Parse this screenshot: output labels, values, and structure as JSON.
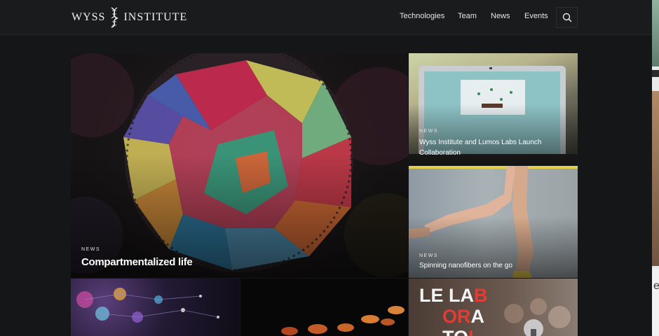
{
  "header": {
    "logo_left": "WYSS",
    "logo_right": "INSTITUTE",
    "nav": [
      {
        "label": "Technologies"
      },
      {
        "label": "Team"
      },
      {
        "label": "News"
      },
      {
        "label": "Events"
      }
    ],
    "search_icon": "search-icon"
  },
  "tiles": [
    {
      "kicker": "NEWS",
      "title": "Compartmentalized life"
    },
    {
      "kicker": "NEWS",
      "title": "Wyss Institute and Lumos Labs Launch Collaboration"
    },
    {
      "kicker": "NEWS",
      "title": "Spinning nanofibers on the go"
    }
  ],
  "lab_tile": {
    "row1": [
      "LE",
      "LA",
      "B"
    ],
    "row2": [
      "OR",
      "A"
    ],
    "row3": [
      "TO",
      "I"
    ]
  },
  "side_strip_glyph": "e",
  "colors": {
    "background": "#151617",
    "header": "#1a1b1c",
    "lab_red": "#e23c34"
  }
}
